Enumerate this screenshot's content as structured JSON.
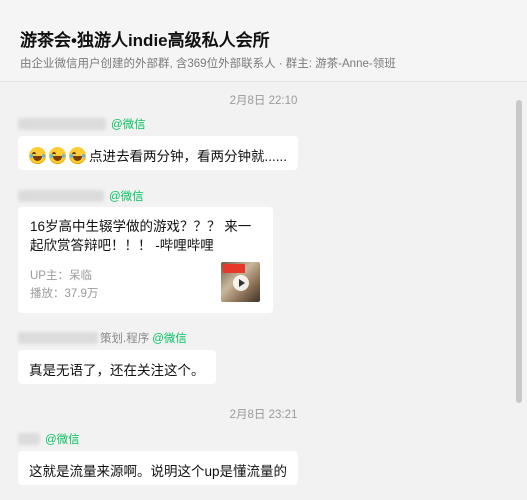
{
  "header": {
    "title": "游茶会•独游人indie高级私人会所",
    "subtitle": "由企业微信用户创建的外部群, 含369位外部联系人 · 群主: 游茶-Anne-领班"
  },
  "messages": [
    {
      "time": "2月8日 22:10",
      "sender_visible": "",
      "sender_tag": "@微信",
      "text": "点进去看两分钟，看两分钟就......",
      "emoji_prefix": [
        "loudly-crying-face-icon",
        "loudly-crying-face-icon",
        "loudly-crying-face-icon"
      ]
    },
    {
      "sender_visible": "",
      "sender_tag": "@微信",
      "card": {
        "title": "16岁高中生辍学做的游戏？？？ 来一起欣赏答辩吧！！！ -哔哩哔哩",
        "up": "UP主：呆临",
        "plays": "播放：37.9万"
      }
    },
    {
      "sender_visible": "策划.程序",
      "sender_tag": "@微信",
      "text": "真是无语了，还在关注这个。"
    },
    {
      "time": "2月8日 23:21",
      "sender_visible": "",
      "sender_tag": "@微信",
      "text": "这就是流量来源啊。说明这个up是懂流量的"
    }
  ],
  "colors": {
    "wechat_green": "#07c160",
    "background": "#f2f2f2",
    "bubble": "#ffffff"
  }
}
